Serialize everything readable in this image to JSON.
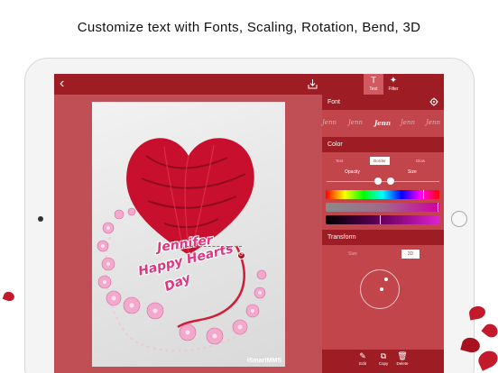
{
  "headline": "Customize text with Fonts, Scaling, Rotation, Bend, 3D",
  "toolbar": {
    "back_icon": "chevron-left-icon",
    "save_icon": "download-icon",
    "text_label": "Text",
    "filter_label": "Filter"
  },
  "canvas": {
    "words": [
      "Jennifer",
      "Happy Hearts",
      "Day"
    ],
    "watermark": "iSmartMMS"
  },
  "panel": {
    "font_title": "Font",
    "fonts": [
      "Jenn",
      "Jenn",
      "Jenn",
      "Jenn",
      "Jenn"
    ],
    "selected_font_index": 2,
    "color_title": "Color",
    "color_tabs": [
      "Text",
      "Border",
      "Glow"
    ],
    "color_selected_tab": "Border",
    "opacity_label": "Opacity",
    "size_label": "Size",
    "transform_title": "Transform",
    "transform_tabs": [
      "Size",
      "3D"
    ],
    "transform_selected_tab": "3D"
  },
  "bottom": {
    "edit_label": "Edit",
    "copy_label": "Copy",
    "delete_label": "Delete"
  },
  "colors": {
    "accent_dark": "#9e1d24",
    "accent": "#b7343b",
    "text_pink": "#e0357f"
  }
}
